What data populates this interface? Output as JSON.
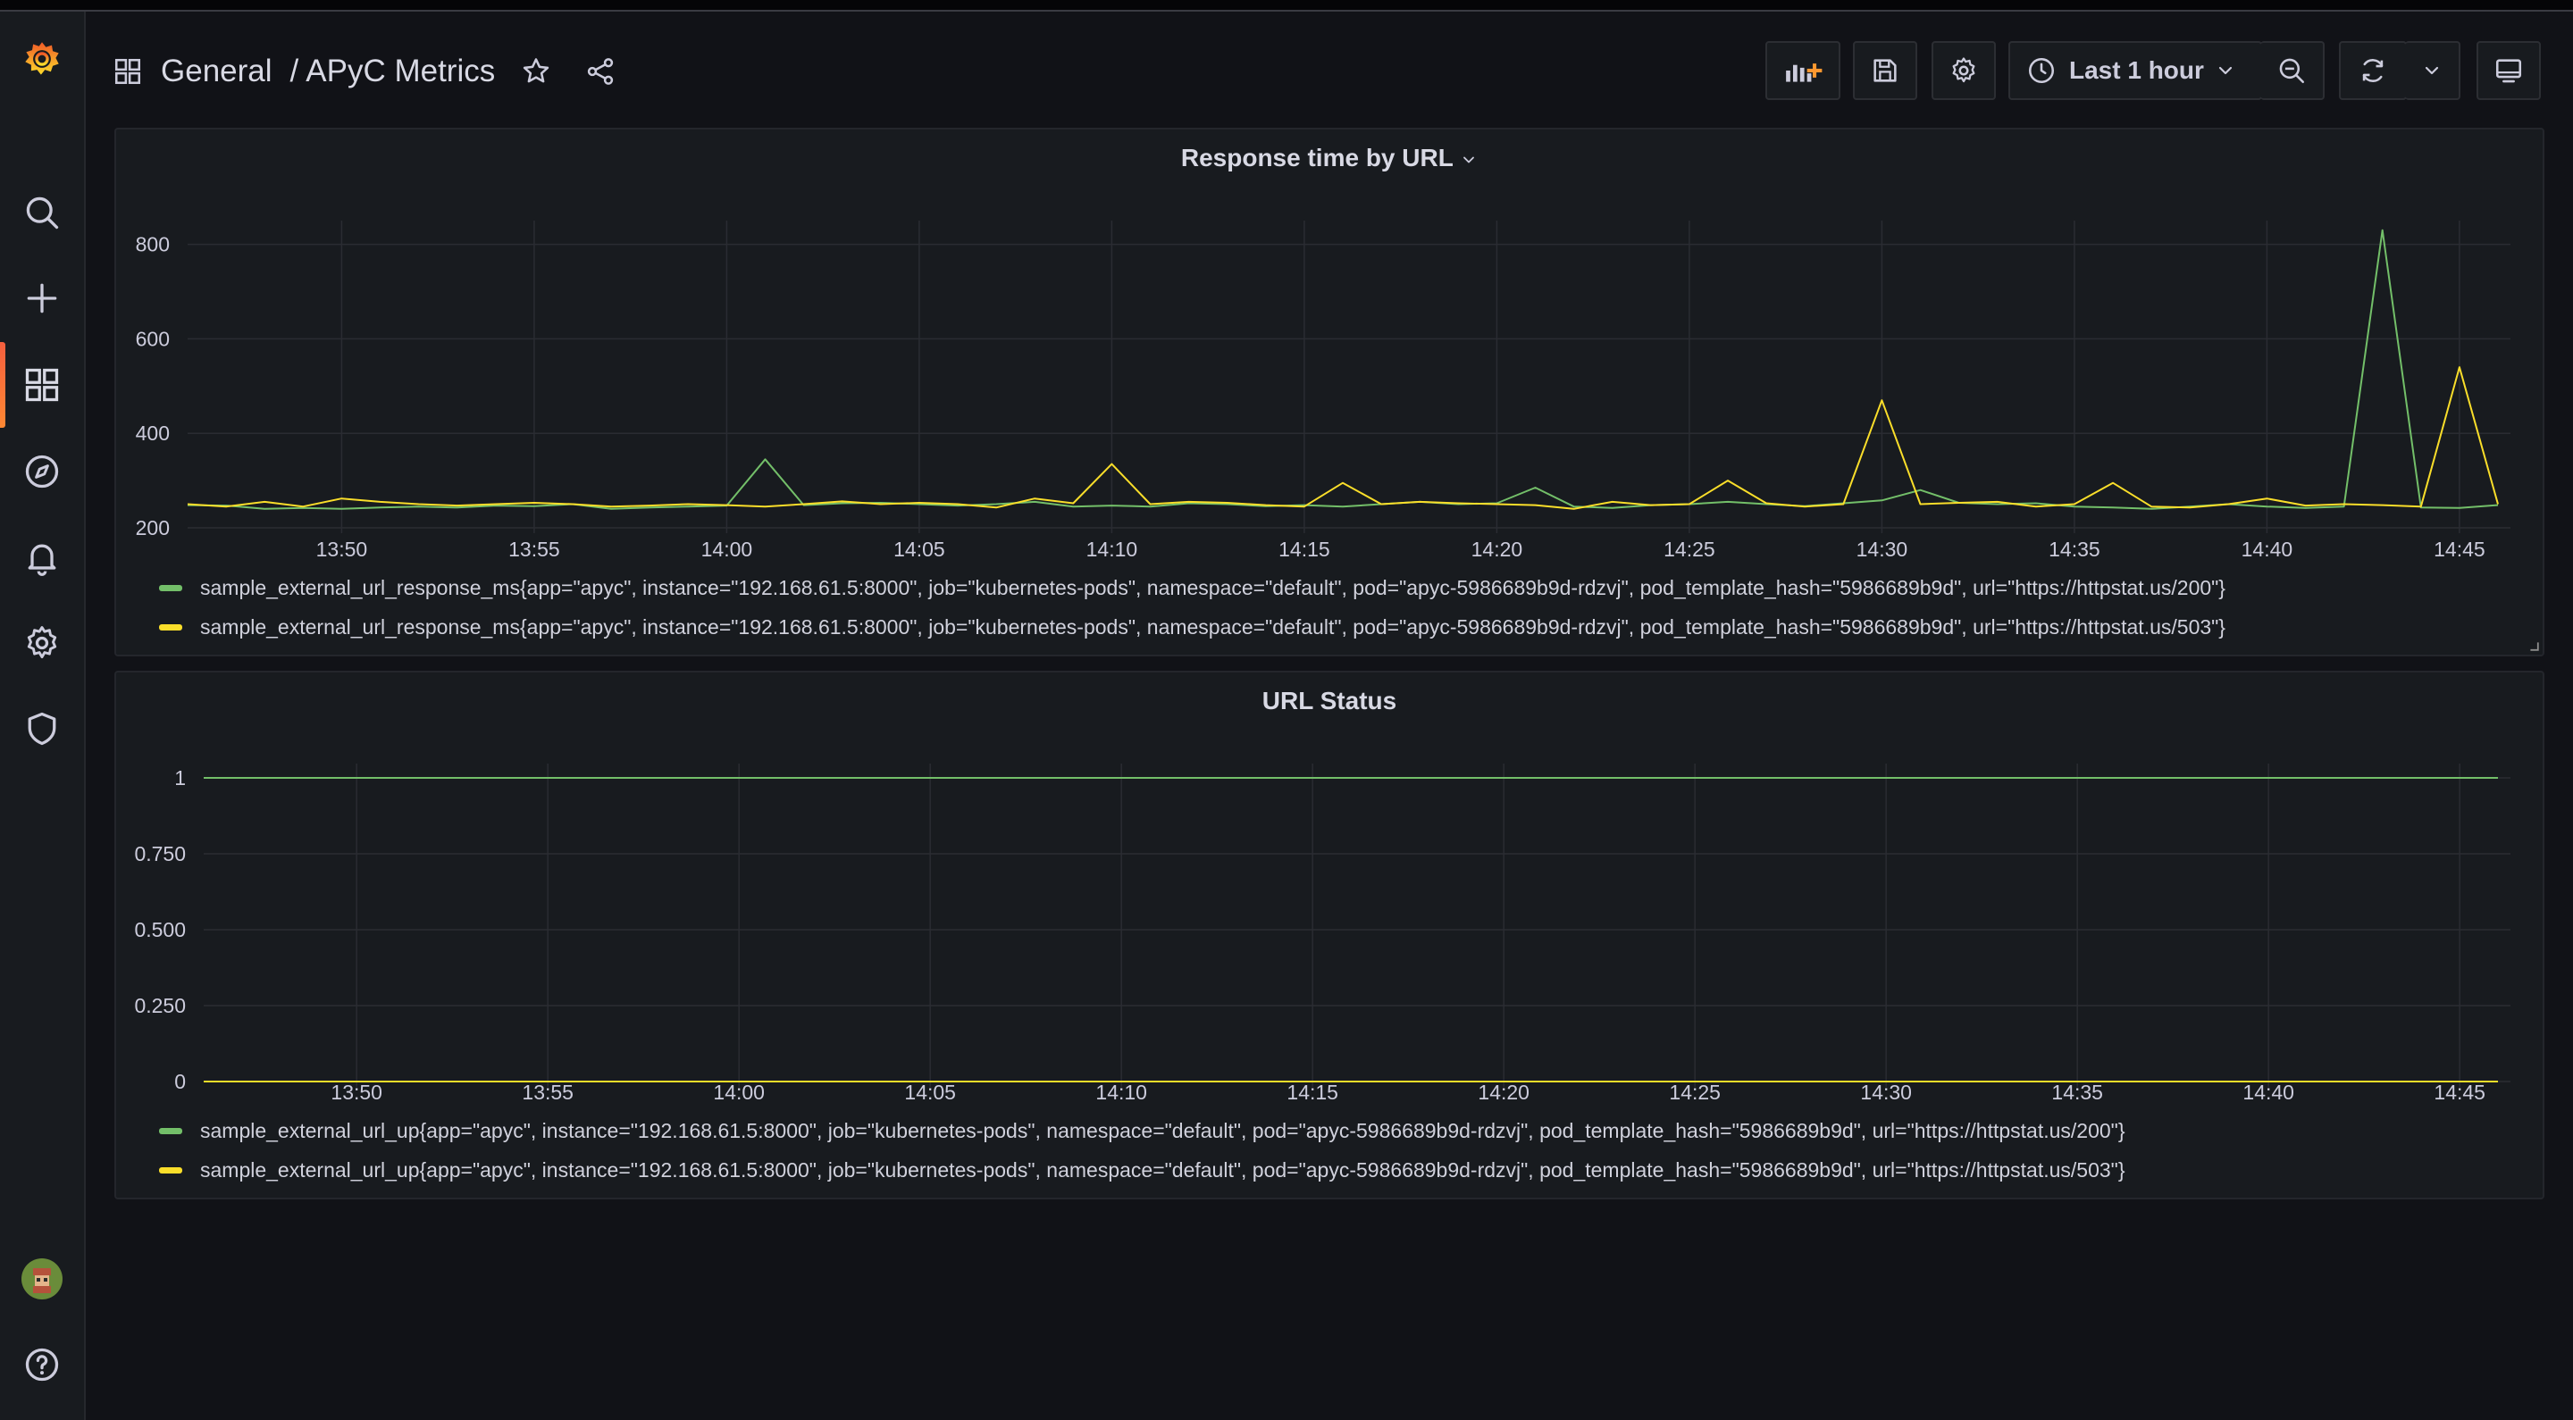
{
  "breadcrumb": {
    "folder": "General",
    "separator": "/",
    "dashboard": "APyC Metrics"
  },
  "toolbar": {
    "time_range": "Last 1 hour"
  },
  "sidebar": {
    "items": [
      {
        "name": "logo-icon"
      },
      {
        "name": "search-icon"
      },
      {
        "name": "plus-icon"
      },
      {
        "name": "dashboards-icon",
        "active": true
      },
      {
        "name": "explore-compass-icon"
      },
      {
        "name": "alert-bell-icon"
      },
      {
        "name": "gear-icon"
      },
      {
        "name": "shield-icon"
      },
      {
        "name": "avatar"
      },
      {
        "name": "help-icon"
      }
    ]
  },
  "colors": {
    "green": "#73bf69",
    "yellow": "#fade2a",
    "accent": "#f55f3e"
  },
  "panels": [
    {
      "title": "Response time by URL",
      "legend": [
        "sample_external_url_response_ms{app=\"apyc\", instance=\"192.168.61.5:8000\", job=\"kubernetes-pods\", namespace=\"default\", pod=\"apyc-5986689b9d-rdzvj\", pod_template_hash=\"5986689b9d\", url=\"https://httpstat.us/200\"}",
        "sample_external_url_response_ms{app=\"apyc\", instance=\"192.168.61.5:8000\", job=\"kubernetes-pods\", namespace=\"default\", pod=\"apyc-5986689b9d-rdzvj\", pod_template_hash=\"5986689b9d\", url=\"https://httpstat.us/503\"}"
      ]
    },
    {
      "title": "URL Status",
      "legend": [
        "sample_external_url_up{app=\"apyc\", instance=\"192.168.61.5:8000\", job=\"kubernetes-pods\", namespace=\"default\", pod=\"apyc-5986689b9d-rdzvj\", pod_template_hash=\"5986689b9d\", url=\"https://httpstat.us/200\"}",
        "sample_external_url_up{app=\"apyc\", instance=\"192.168.61.5:8000\", job=\"kubernetes-pods\", namespace=\"default\", pod=\"apyc-5986689b9d-rdzvj\", pod_template_hash=\"5986689b9d\", url=\"https://httpstat.us/503\"}"
      ]
    }
  ],
  "chart_data": [
    {
      "type": "line",
      "title": "Response time by URL",
      "x_ticks": [
        "13:50",
        "13:55",
        "14:00",
        "14:05",
        "14:10",
        "14:15",
        "14:20",
        "14:25",
        "14:30",
        "14:35",
        "14:40",
        "14:45"
      ],
      "y_ticks": [
        "200",
        "400",
        "600",
        "800"
      ],
      "ylim": [
        200,
        820
      ],
      "xlim": [
        "13:46",
        "14:46"
      ],
      "grid": true,
      "legend_placement": "bottom",
      "x": [
        "13:46",
        "13:47",
        "13:48",
        "13:49",
        "13:50",
        "13:51",
        "13:52",
        "13:53",
        "13:54",
        "13:55",
        "13:56",
        "13:57",
        "13:58",
        "13:59",
        "14:00",
        "14:01",
        "14:02",
        "14:03",
        "14:04",
        "14:05",
        "14:06",
        "14:07",
        "14:08",
        "14:09",
        "14:10",
        "14:11",
        "14:12",
        "14:13",
        "14:14",
        "14:15",
        "14:16",
        "14:17",
        "14:18",
        "14:19",
        "14:20",
        "14:21",
        "14:22",
        "14:23",
        "14:24",
        "14:25",
        "14:26",
        "14:27",
        "14:28",
        "14:29",
        "14:30",
        "14:31",
        "14:32",
        "14:33",
        "14:34",
        "14:35",
        "14:36",
        "14:37",
        "14:38",
        "14:39",
        "14:40",
        "14:41",
        "14:42",
        "14:43",
        "14:44",
        "14:45",
        "14:46"
      ],
      "series": [
        {
          "values": [
            248,
            247,
            240,
            242,
            240,
            243,
            245,
            243,
            247,
            246,
            250,
            240,
            243,
            245,
            247,
            345,
            248,
            252,
            253,
            250,
            247,
            250,
            255,
            245,
            247,
            245,
            252,
            250,
            246,
            248,
            245,
            250,
            255,
            250,
            252,
            285,
            245,
            242,
            248,
            250,
            255,
            250,
            246,
            252,
            258,
            280,
            253,
            250,
            252,
            245,
            243,
            240,
            245,
            250,
            245,
            242,
            245,
            830,
            243,
            242,
            248
          ]
        },
        {
          "values": [
            250,
            245,
            255,
            245,
            262,
            255,
            250,
            247,
            250,
            253,
            250,
            245,
            247,
            250,
            248,
            245,
            250,
            256,
            250,
            253,
            250,
            243,
            262,
            252,
            335,
            250,
            255,
            253,
            248,
            245,
            295,
            250,
            255,
            252,
            250,
            248,
            240,
            255,
            248,
            250,
            300,
            252,
            245,
            250,
            470,
            250,
            253,
            255,
            245,
            250,
            295,
            245,
            243,
            250,
            262,
            247,
            250,
            248,
            245,
            540,
            250
          ]
        }
      ]
    },
    {
      "type": "line",
      "title": "URL Status",
      "x_ticks": [
        "13:50",
        "13:55",
        "14:00",
        "14:05",
        "14:10",
        "14:15",
        "14:20",
        "14:25",
        "14:30",
        "14:35",
        "14:40",
        "14:45"
      ],
      "y_ticks": [
        "0",
        "0.250",
        "0.500",
        "0.750",
        "1"
      ],
      "ylim": [
        0,
        1
      ],
      "xlim": [
        "13:46",
        "14:46"
      ],
      "grid": true,
      "legend_placement": "bottom",
      "series": [
        {
          "x": [
            "13:46",
            "14:46"
          ],
          "values": [
            1,
            1
          ]
        },
        {
          "x": [
            "13:46",
            "14:46"
          ],
          "values": [
            0,
            0
          ]
        }
      ]
    }
  ]
}
